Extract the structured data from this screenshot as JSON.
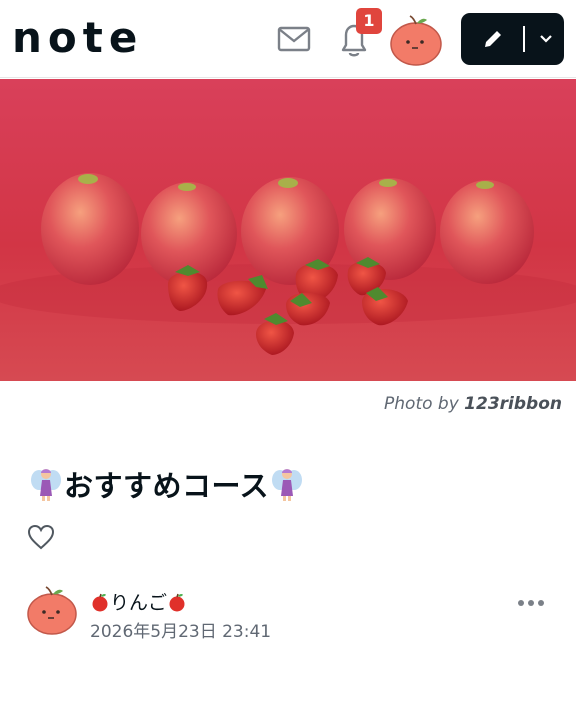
{
  "header": {
    "logo": "note",
    "notification_count": "1",
    "post_button_icon": "pencil-icon",
    "colors": {
      "text": "#08131a",
      "badge": "#e0453d",
      "post_button_bg": "#08131a"
    }
  },
  "hero": {
    "credit_prefix": "Photo by",
    "credit_name": "123ribbon",
    "colors": {
      "background": "#d5384b",
      "apple": "#e0565a",
      "strawberry": "#c9202b"
    }
  },
  "article": {
    "title": "おすすめコース",
    "title_emoji": "fairy-emoji"
  },
  "author": {
    "name": "りんご",
    "name_emoji": "apple-emoji",
    "date": "2026年5月23日 23:41"
  }
}
